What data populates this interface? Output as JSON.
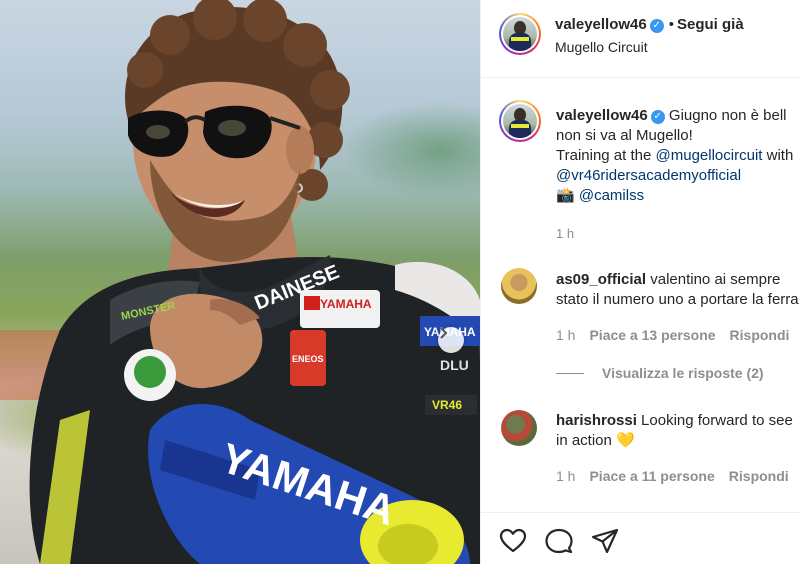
{
  "photo": {
    "alt_icon": "photo-carousel",
    "carousel_arrow": "chevron-right-icon",
    "suit_text": {
      "brand": "YAMAHA",
      "sponsor": "DAINESE",
      "energy": "MONSTER",
      "eneos": "ENEOS",
      "academy": "YAMAHA",
      "dunlop": "DLU",
      "vr": "VR46"
    }
  },
  "header": {
    "username": "valeyellow46",
    "dot": "•",
    "follow_label": "Segui già",
    "location": "Mugello Circuit"
  },
  "caption": {
    "username": "valeyellow46",
    "line1_text": "Giugno non è bell",
    "line2_text": "non si va al Mugello!",
    "line3_prefix": "Training at the",
    "line3_mention": "@mugellocircuit",
    "line3_suffix": "with",
    "line4_mention": "@vr46ridersacademyofficial",
    "line5_emoji": "📸",
    "line5_mention": "@camilss",
    "time": "1 h"
  },
  "comments": [
    {
      "username": "as09_official",
      "line1": "valentino ai sempre",
      "line2": "stato il numero uno a portare la ferra",
      "time": "1 h",
      "likes": "Piace a 13 persone",
      "reply": "Rispondi"
    },
    {
      "username": "harishrossi",
      "line1": "Looking forward to see",
      "line2": "in action 💛",
      "time": "1 h",
      "likes": "Piace a 11 persone",
      "reply": "Rispondi"
    }
  ],
  "view_replies": "Visualizza le risposte (2)",
  "actions": {
    "like": "heart-icon",
    "comment": "comment-icon",
    "share": "send-icon"
  },
  "colors": {
    "verified": "#3897f0",
    "mention": "#00376b",
    "muted": "#8e8e8e",
    "text": "#262626"
  }
}
